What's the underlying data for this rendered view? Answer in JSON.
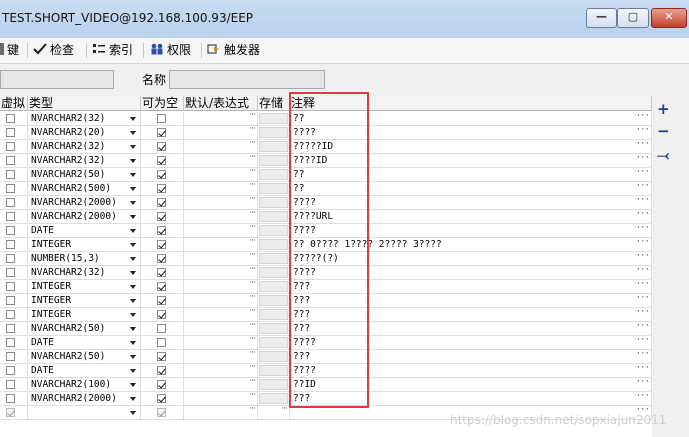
{
  "window": {
    "title": "TEST.SHORT_VIDEO@192.168.100.93/EEP",
    "min_glyph": "—",
    "max_glyph": "▢",
    "close_glyph": "✕"
  },
  "toolbar": {
    "items": [
      {
        "label": "键",
        "icon": "key-icon"
      },
      {
        "label": "检查",
        "icon": "check-icon"
      },
      {
        "label": "索引",
        "icon": "index-icon"
      },
      {
        "label": "权限",
        "icon": "users-icon"
      },
      {
        "label": "触发器",
        "icon": "trigger-icon"
      }
    ]
  },
  "form": {
    "name_label": "名称",
    "name_value": ""
  },
  "columns": [
    "虚拟",
    "类型",
    "可为空",
    "默认/表达式",
    "存储",
    "注释"
  ],
  "rows": [
    {
      "virtual": false,
      "type": "NVARCHAR2(32)",
      "nullable": false,
      "comment": "??"
    },
    {
      "virtual": false,
      "type": "NVARCHAR2(20)",
      "nullable": true,
      "comment": "????"
    },
    {
      "virtual": false,
      "type": "NVARCHAR2(32)",
      "nullable": true,
      "comment": "?????ID"
    },
    {
      "virtual": false,
      "type": "NVARCHAR2(32)",
      "nullable": true,
      "comment": "????ID"
    },
    {
      "virtual": false,
      "type": "NVARCHAR2(50)",
      "nullable": true,
      "comment": "??"
    },
    {
      "virtual": false,
      "type": "NVARCHAR2(500)",
      "nullable": true,
      "comment": "??"
    },
    {
      "virtual": false,
      "type": "NVARCHAR2(2000)",
      "nullable": true,
      "comment": "????"
    },
    {
      "virtual": false,
      "type": "NVARCHAR2(2000)",
      "nullable": true,
      "comment": "????URL"
    },
    {
      "virtual": false,
      "type": "DATE",
      "nullable": true,
      "comment": "????"
    },
    {
      "virtual": false,
      "type": "INTEGER",
      "nullable": true,
      "comment": "?? 0???? 1???? 2???? 3????"
    },
    {
      "virtual": false,
      "type": "NUMBER(15,3)",
      "nullable": true,
      "comment": "?????(?)"
    },
    {
      "virtual": false,
      "type": "NVARCHAR2(32)",
      "nullable": true,
      "comment": "????"
    },
    {
      "virtual": false,
      "type": "INTEGER",
      "nullable": true,
      "comment": "???"
    },
    {
      "virtual": false,
      "type": "INTEGER",
      "nullable": true,
      "comment": "???"
    },
    {
      "virtual": false,
      "type": "INTEGER",
      "nullable": true,
      "comment": "???"
    },
    {
      "virtual": false,
      "type": "NVARCHAR2(50)",
      "nullable": false,
      "comment": "???"
    },
    {
      "virtual": false,
      "type": "DATE",
      "nullable": false,
      "comment": "????"
    },
    {
      "virtual": false,
      "type": "NVARCHAR2(50)",
      "nullable": true,
      "comment": "???"
    },
    {
      "virtual": false,
      "type": "DATE",
      "nullable": true,
      "comment": "????"
    },
    {
      "virtual": false,
      "type": "NVARCHAR2(100)",
      "nullable": true,
      "comment": "??ID"
    },
    {
      "virtual": false,
      "type": "NVARCHAR2(2000)",
      "nullable": true,
      "comment": "???"
    }
  ],
  "new_row": {
    "virtual": true,
    "type": "",
    "nullable": true,
    "comment": ""
  },
  "side_buttons": [
    "+",
    "−",
    "⤙"
  ],
  "watermark": "https://blog.csdn.net/sopxiajun2011",
  "colors": {
    "highlight": "#e03a3a",
    "titlebar": "#c9dcf2"
  }
}
